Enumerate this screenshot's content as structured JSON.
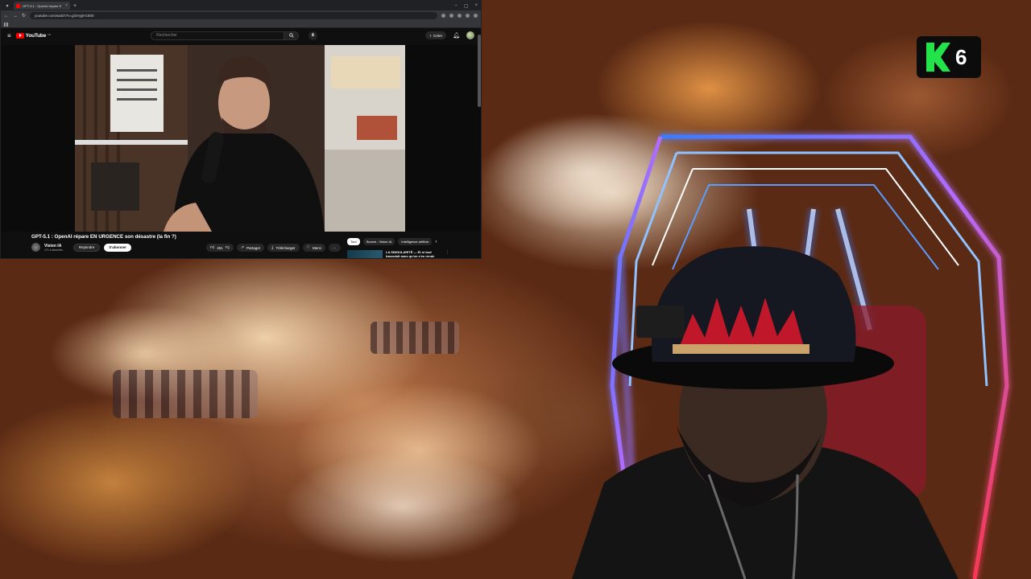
{
  "browser": {
    "tab_title": "GPT-5.1 : OpenAI répare E",
    "url": "youtube.com/watch?v=gOmyjiH1800",
    "colors": {
      "tab_favicon": "#ff0000"
    }
  },
  "youtube": {
    "logo_text": "YouTube",
    "logo_country": "FR",
    "search_placeholder": "Rechercher",
    "create_label": "Créer",
    "video_title": "GPT-5.1 : OpenAI répare EN URGENCE son désastre (la fin ?)",
    "channel_name": "Vision IA",
    "channel_subscribers": "171 k abonnés",
    "join_label": "Rejoindre",
    "subscribe_label": "S'abonner",
    "likes": "451",
    "share_label": "Partager",
    "download_label": "Télécharger",
    "save_label": "Merci",
    "chips": [
      "Tout",
      "Source : Vision IA",
      "Intelligence artificie"
    ],
    "recommendation_title": "LA SINGULARITÉ — Et si tout basculait sans qu'on s'en rende"
  },
  "overlay": {
    "logo_number": "6",
    "colors": {
      "logo_k": "#22e34a",
      "neon_blue": "#2f7bff",
      "neon_red": "#ff3344"
    }
  }
}
